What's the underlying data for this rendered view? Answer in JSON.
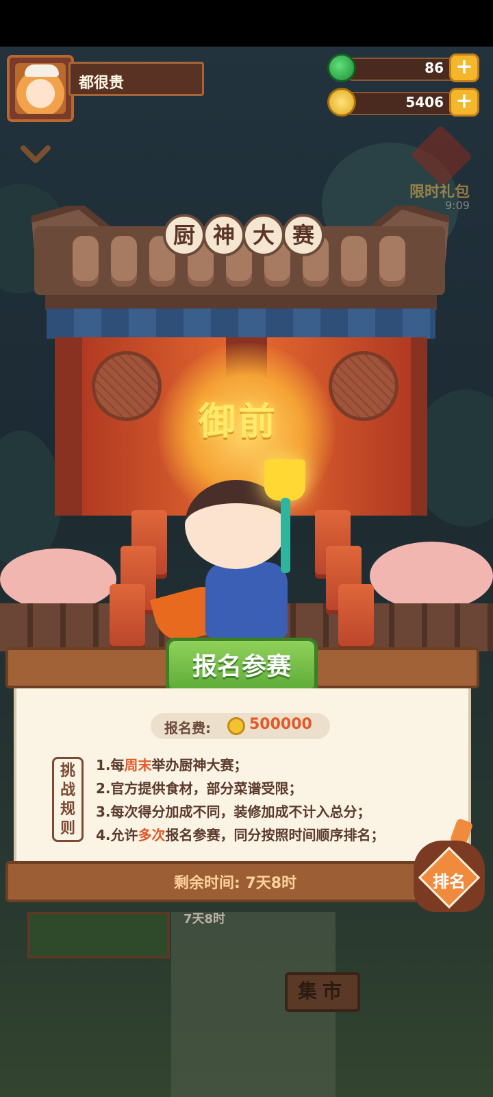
{
  "player": {
    "name": "都很贵"
  },
  "currencies": {
    "jade": {
      "value": "86",
      "icon": "jade-icon"
    },
    "coins": {
      "value": "5406",
      "icon": "coin-icon"
    }
  },
  "gift": {
    "label": "限时礼包",
    "timer": "9:09"
  },
  "event": {
    "title_chars": [
      "厨",
      "神",
      "大",
      "赛"
    ],
    "tier": "御前",
    "signup_button": "报名参赛",
    "fee_label": "报名费:",
    "fee_value": "500000",
    "rules_tag": "挑战规则",
    "rules": [
      {
        "pre": "1.每",
        "hl": "周末",
        "post": "举办厨神大赛；"
      },
      {
        "pre": "2.官方提供食材，部分菜谱受限；",
        "hl": "",
        "post": ""
      },
      {
        "pre": "3.每次得分加成不同，装修加成不计入总分；",
        "hl": "",
        "post": ""
      },
      {
        "pre": "4.允许",
        "hl": "多次",
        "post": "报名参赛，同分按照时间顺序排名；"
      }
    ],
    "timer_text": "剩余时间: 7天8时",
    "rank_button": "排名"
  },
  "background": {
    "timer_label": "7天8时",
    "market_label": "集市"
  }
}
